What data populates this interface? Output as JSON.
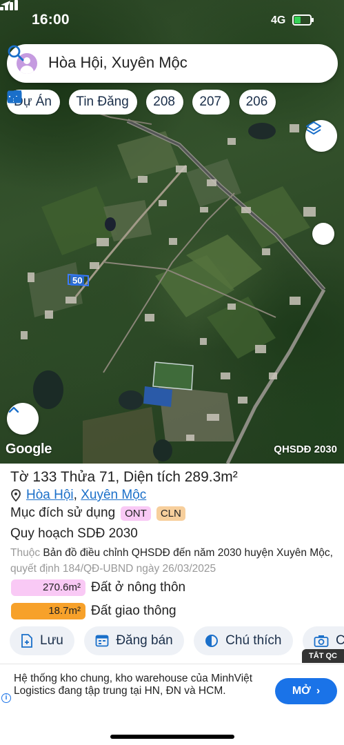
{
  "status_bar": {
    "time": "16:00",
    "network": "4G",
    "battery_level": 0.4
  },
  "search": {
    "query": "Hòa Hội, Xuyên Mộc"
  },
  "chips": [
    {
      "label": "Dự Án",
      "icon": "project-icon"
    },
    {
      "label": "Tin Đăng",
      "icon": "listing-icon"
    },
    {
      "label": "208",
      "icon": "map-sheet-icon"
    },
    {
      "label": "207",
      "icon": "map-sheet-icon"
    },
    {
      "label": "206",
      "icon": "map-sheet-icon"
    }
  ],
  "map": {
    "parcel_marker": "50",
    "logo": "Google",
    "mode": "QHSDĐ 2030"
  },
  "parcel": {
    "title": "Tờ 133 Thửa 71, Diện tích 289.3m²",
    "location": {
      "commune": "Hòa Hội",
      "separator": ", ",
      "district": "Xuyên Mộc"
    },
    "purpose_label": "Mục đích sử dụng",
    "purpose_codes": [
      {
        "code": "ONT",
        "color": "#f9c9f5"
      },
      {
        "code": "CLN",
        "color": "#f7cf9c"
      }
    ],
    "plan_title": "Quy hoạch SDĐ 2030",
    "plan_desc": {
      "prefix": "Thuộc",
      "map_name": "Bản đồ điều chỉnh QHSDĐ đến năm 2030 huyện Xuyên Mộc,",
      "decision": "quyết định 184/QĐ-UBND ngày 26/03/2025"
    },
    "landuse": [
      {
        "area": "270.6m²",
        "label": "Đất ở nông thôn",
        "color": "#f9c9f5"
      },
      {
        "area": "18.7m²",
        "label": "Đất giao thông",
        "color": "#f7a12a"
      }
    ]
  },
  "actions": [
    {
      "label": "Lưu",
      "icon": "save-icon"
    },
    {
      "label": "Đăng bán",
      "icon": "post-sale-icon"
    },
    {
      "label": "Chú thích",
      "icon": "legend-icon"
    },
    {
      "label": "C",
      "icon": "camera-icon"
    }
  ],
  "ad": {
    "close_label": "TẮT QC",
    "text": "Hệ thống kho chung, kho warehouse của MinhViệt Logistics đang tập trung tại HN, ĐN và HCM.",
    "info": "i",
    "cta": "MỞ"
  }
}
